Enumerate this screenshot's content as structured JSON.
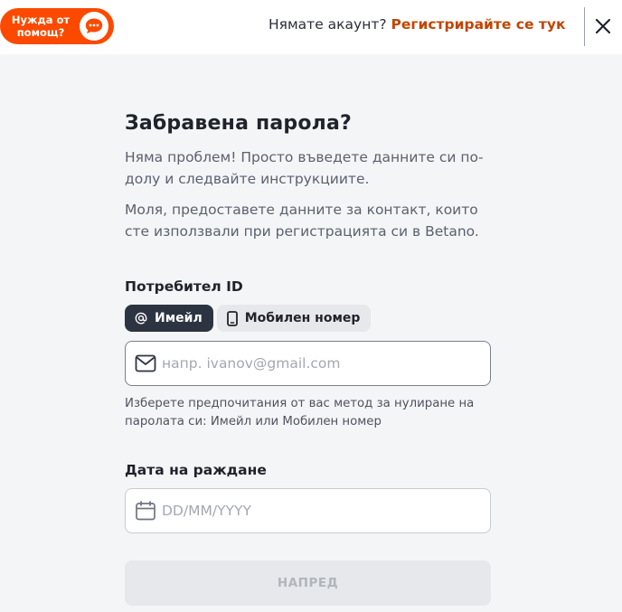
{
  "header": {
    "help_label": "Нужда от помощ?",
    "no_account_text": "Нямате акаунт?",
    "register_link": "Регистрирайте се тук",
    "close_icon": "close-icon",
    "chat_icon": "chat-bubble-icon"
  },
  "form": {
    "title": "Забравена парола?",
    "description_1": "Няма проблем! Просто въведете данните си по-долу и следвайте инструкциите.",
    "description_2": "Моля, предоставете данните за контакт, които сте използвали при регистрацията си в Betano.",
    "user_id_label": "Потребител ID",
    "toggle_email": "Имейл",
    "toggle_mobile": "Мобилен номер",
    "email_placeholder": "напр. ivanov@gmail.com",
    "email_value": "",
    "hint": "Изберете предпочитания от вас метод за нулиране на паролата си: Имейл или Мобилен номер",
    "dob_label": "Дата на раждане",
    "dob_placeholder": "DD/MM/YYYY",
    "dob_value": "",
    "next_button": "НАПРЕД"
  },
  "colors": {
    "brand_orange": "#fb4a00",
    "link_orange": "#c24500",
    "dark": "#2d3441"
  }
}
